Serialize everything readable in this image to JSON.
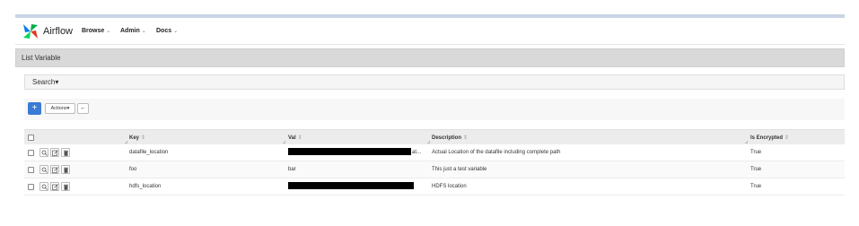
{
  "app": {
    "brand_name": "Airflow",
    "nav_text_color": "#222222"
  },
  "nav": {
    "items": [
      {
        "label": "Browse"
      },
      {
        "label": "Admin"
      },
      {
        "label": "Docs"
      }
    ],
    "caret": "⌄"
  },
  "page": {
    "title": "List Variable"
  },
  "search": {
    "label": "Search",
    "caret": "▾"
  },
  "toolbar": {
    "add_label": "+",
    "actions_label": "Actions",
    "actions_caret": "▾",
    "back_label": "←",
    "add_color": "#3a7bd5"
  },
  "table": {
    "columns": {
      "key": "Key",
      "val": "Val",
      "description": "Description",
      "is_encrypted": "Is Encrypted",
      "sort_icon": "⇕"
    },
    "rows": [
      {
        "key": "datafile_location",
        "val": "",
        "val_redacted": true,
        "val_suffix": "at...",
        "description": "Actual Location of the datafile including complete path",
        "is_encrypted": "True"
      },
      {
        "key": "foo",
        "val": "bar",
        "val_redacted": false,
        "val_suffix": "",
        "description": "This just a test variable",
        "is_encrypted": "True"
      },
      {
        "key": "hdfs_location",
        "val": "",
        "val_redacted": true,
        "val_suffix": "",
        "description": "HDFS location",
        "is_encrypted": "True"
      }
    ],
    "row_icons": [
      "search-icon",
      "edit-icon",
      "trash-icon"
    ]
  }
}
